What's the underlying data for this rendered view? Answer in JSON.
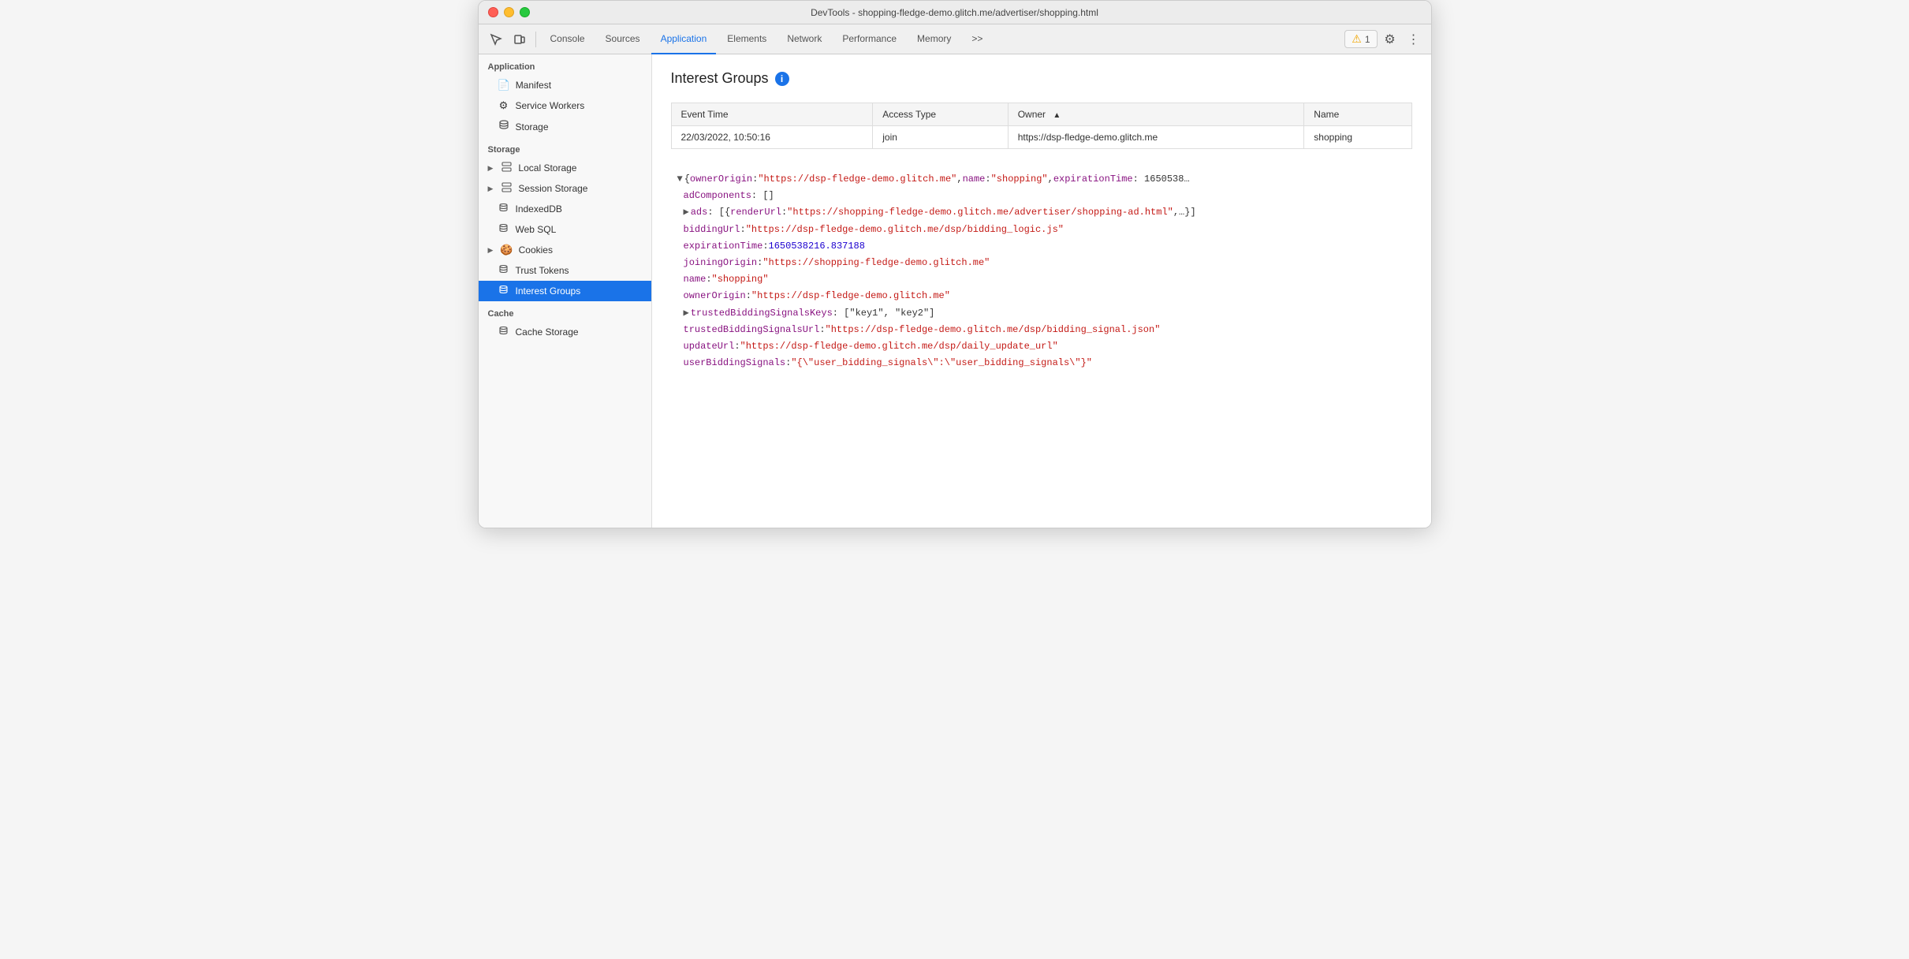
{
  "titlebar": {
    "title": "DevTools - shopping-fledge-demo.glitch.me/advertiser/shopping.html"
  },
  "toolbar": {
    "tabs": [
      {
        "label": "Console",
        "active": false
      },
      {
        "label": "Sources",
        "active": false
      },
      {
        "label": "Application",
        "active": true
      },
      {
        "label": "Elements",
        "active": false
      },
      {
        "label": "Network",
        "active": false
      },
      {
        "label": "Performance",
        "active": false
      },
      {
        "label": "Memory",
        "active": false
      }
    ],
    "warning_count": "1",
    "more_label": ">>"
  },
  "sidebar": {
    "application_label": "Application",
    "app_items": [
      {
        "label": "Manifest",
        "icon": "📄"
      },
      {
        "label": "Service Workers",
        "icon": "⚙️"
      },
      {
        "label": "Storage",
        "icon": "🗄️"
      }
    ],
    "storage_label": "Storage",
    "storage_items": [
      {
        "label": "Local Storage",
        "expandable": true,
        "icon": "⊞"
      },
      {
        "label": "Session Storage",
        "expandable": true,
        "icon": "⊞"
      },
      {
        "label": "IndexedDB",
        "expandable": false,
        "icon": "🗄️"
      },
      {
        "label": "Web SQL",
        "expandable": false,
        "icon": "🗄️"
      },
      {
        "label": "Cookies",
        "expandable": true,
        "icon": "🍪"
      },
      {
        "label": "Trust Tokens",
        "expandable": false,
        "icon": "🗄️"
      },
      {
        "label": "Interest Groups",
        "expandable": false,
        "icon": "🗄️",
        "active": true
      }
    ],
    "cache_label": "Cache",
    "cache_items": [
      {
        "label": "Cache Storage",
        "expandable": false,
        "icon": "🗄️"
      }
    ]
  },
  "content": {
    "page_title": "Interest Groups",
    "table": {
      "headers": [
        "Event Time",
        "Access Type",
        "Owner",
        "Name"
      ],
      "rows": [
        {
          "event_time": "22/03/2022, 10:50:16",
          "access_type": "join",
          "owner": "https://dsp-fledge-demo.glitch.me",
          "name": "shopping"
        }
      ]
    },
    "json_lines": [
      {
        "indent": 0,
        "content": "▼ {ownerOrigin: \"https://dsp-fledge-demo.glitch.me\", name: \"shopping\", expirationTime: 1650538…",
        "type": "plain"
      },
      {
        "indent": 1,
        "content": "adComponents: []",
        "key": "adComponents",
        "value": "[]",
        "type": "key-plain"
      },
      {
        "indent": 1,
        "expand": "▶",
        "content": "ads: [{renderUrl: \"https://shopping-fledge-demo.glitch.me/advertiser/shopping-ad.html\",…}]",
        "type": "expandable"
      },
      {
        "indent": 1,
        "content": "biddingUrl: \"https://dsp-fledge-demo.glitch.me/dsp/bidding_logic.js\"",
        "key": "biddingUrl",
        "value": "\"https://dsp-fledge-demo.glitch.me/dsp/bidding_logic.js\"",
        "type": "key-string"
      },
      {
        "indent": 1,
        "content": "expirationTime: 1650538216.837188",
        "key": "expirationTime",
        "value": "1650538216.837188",
        "type": "key-number"
      },
      {
        "indent": 1,
        "content": "joiningOrigin: \"https://shopping-fledge-demo.glitch.me\"",
        "key": "joiningOrigin",
        "value": "\"https://shopping-fledge-demo.glitch.me\"",
        "type": "key-string"
      },
      {
        "indent": 1,
        "content": "name: \"shopping\"",
        "key": "name",
        "value": "\"shopping\"",
        "type": "key-string"
      },
      {
        "indent": 1,
        "content": "ownerOrigin: \"https://dsp-fledge-demo.glitch.me\"",
        "key": "ownerOrigin",
        "value": "\"https://dsp-fledge-demo.glitch.me\"",
        "type": "key-string"
      },
      {
        "indent": 1,
        "expand": "▶",
        "content": "trustedBiddingSignalsKeys: [\"key1\", \"key2\"]",
        "type": "expandable-plain"
      },
      {
        "indent": 1,
        "content": "trustedBiddingSignalsUrl: \"https://dsp-fledge-demo.glitch.me/dsp/bidding_signal.json\"",
        "key": "trustedBiddingSignalsUrl",
        "value": "\"https://dsp-fledge-demo.glitch.me/dsp/bidding_signal.json\"",
        "type": "key-string"
      },
      {
        "indent": 1,
        "content": "updateUrl: \"https://dsp-fledge-demo.glitch.me/dsp/daily_update_url\"",
        "key": "updateUrl",
        "value": "\"https://dsp-fledge-demo.glitch.me/dsp/daily_update_url\"",
        "type": "key-string"
      },
      {
        "indent": 1,
        "content": "userBiddingSignals: \"{\\\"user_bidding_signals\\\":\\\"user_bidding_signals\\\"}\"",
        "key": "userBiddingSignals",
        "value": "\"{\\\"user_bidding_signals\\\":\\\"user_bidding_signals\\\"}\"",
        "type": "key-string"
      }
    ]
  }
}
